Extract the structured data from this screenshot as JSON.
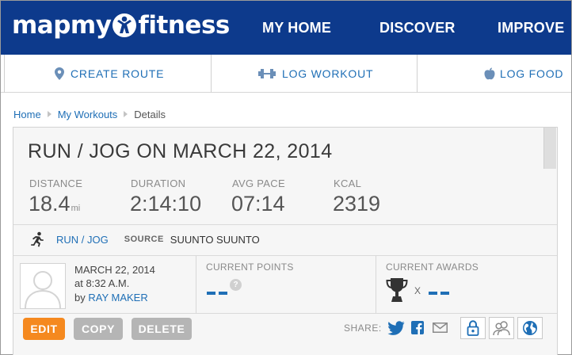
{
  "header": {
    "logo": {
      "prefix": "mapmy",
      "suffix": "fitness"
    },
    "nav": [
      "MY HOME",
      "DISCOVER",
      "IMPROVE"
    ]
  },
  "actions": {
    "create_route": "CREATE ROUTE",
    "log_workout": "LOG WORKOUT",
    "log_food": "LOG FOOD"
  },
  "breadcrumb": [
    "Home",
    "My Workouts",
    "Details"
  ],
  "workout": {
    "title": "RUN / JOG ON MARCH 22, 2014",
    "stats": {
      "distance": {
        "label": "DISTANCE",
        "value": "18.4",
        "unit": "mi"
      },
      "duration": {
        "label": "DURATION",
        "value": "2:14:10"
      },
      "avg_pace": {
        "label": "AVG PACE",
        "value": "07:14"
      },
      "kcal": {
        "label": "KCAL",
        "value": "2319"
      }
    },
    "type": "RUN / JOG",
    "source_label": "SOURCE",
    "source_value": "SUUNTO SUUNTO",
    "date": "MARCH 22, 2014",
    "time": "at 8:32 A.M.",
    "by_label": "by",
    "author": "RAY MAKER"
  },
  "points": {
    "label": "CURRENT POINTS",
    "help": "?"
  },
  "awards": {
    "label": "CURRENT AWARDS",
    "times": "X"
  },
  "buttons": {
    "edit": "EDIT",
    "copy": "COPY",
    "delete": "DELETE"
  },
  "share": {
    "label": "SHARE:"
  },
  "colors": {
    "header_bg": "#0d3a8c",
    "link": "#1f6fb6",
    "edit_button": "#f5891f",
    "neutral_button": "#b5b5b5"
  },
  "icons": {
    "logo_mark": "runner-x-icon",
    "create_route": "map-pin-icon",
    "log_workout": "dumbbell-icon",
    "log_food": "apple-icon",
    "activity": "runner-icon",
    "awards": "trophy-icon",
    "share": [
      "twitter-icon",
      "facebook-icon",
      "email-icon"
    ],
    "privacy": [
      "lock-icon",
      "friends-icon",
      "globe-icon"
    ]
  }
}
